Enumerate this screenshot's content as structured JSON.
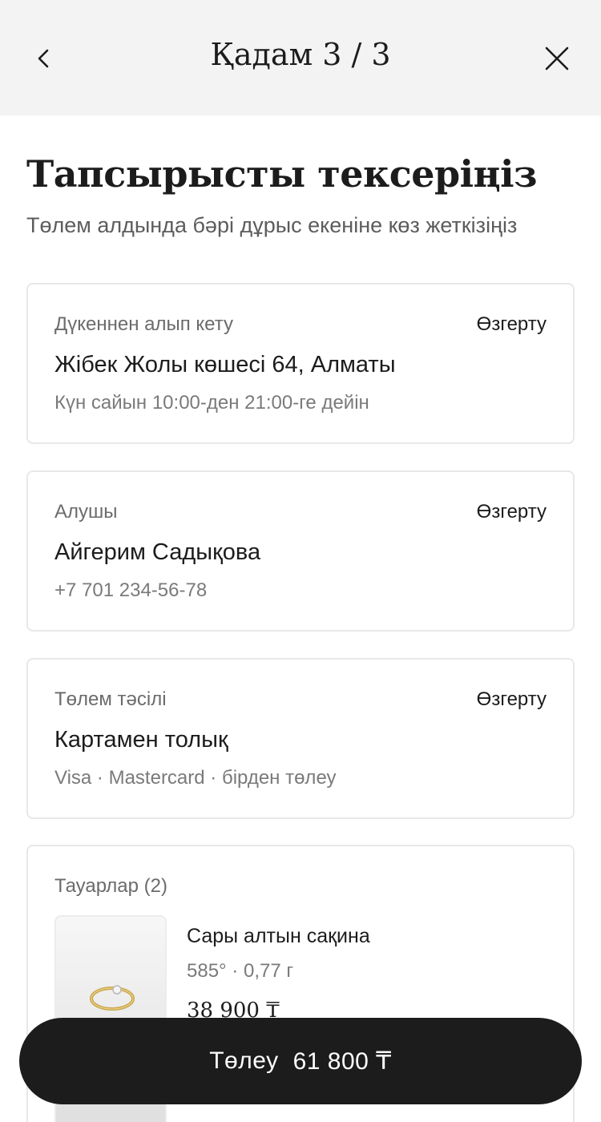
{
  "header": {
    "step_title": "Қадам 3 / 3",
    "back_icon": "chevron-left-icon",
    "close_icon": "close-icon"
  },
  "page": {
    "title": "Тапсырысты тексеріңіз",
    "subtitle": "Төлем алдында бәрі дұрыс екеніне көз жеткізіңіз"
  },
  "pickup": {
    "label": "Дүкеннен алып кету",
    "change_label": "Өзгерту",
    "address": "Жібек Жолы көшесі 64, Алматы",
    "hours": "Күн сайын 10:00-ден 21:00-ге дейін"
  },
  "recipient": {
    "label": "Алушы",
    "change_label": "Өзгерту",
    "name": "Айгерим Садықова",
    "phone": "+7 701 234-56-78"
  },
  "payment": {
    "label": "Төлем тәсілі",
    "change_label": "Өзгерту",
    "method": "Картамен толық",
    "details": "Visa · Mastercard · бірден төлеу"
  },
  "items": {
    "label": "Тауарлар (2)",
    "list": [
      {
        "name": "Сары алтын сақина",
        "spec": "585° · 0,77 г",
        "price": "38 900 ₸"
      }
    ]
  },
  "footer": {
    "pay_label": "Төлеу",
    "pay_total": "61 800 ₸"
  },
  "colors": {
    "accent": "#1c1c1c",
    "header_bg": "#f3f3f3",
    "card_border": "#e8e8e8"
  }
}
